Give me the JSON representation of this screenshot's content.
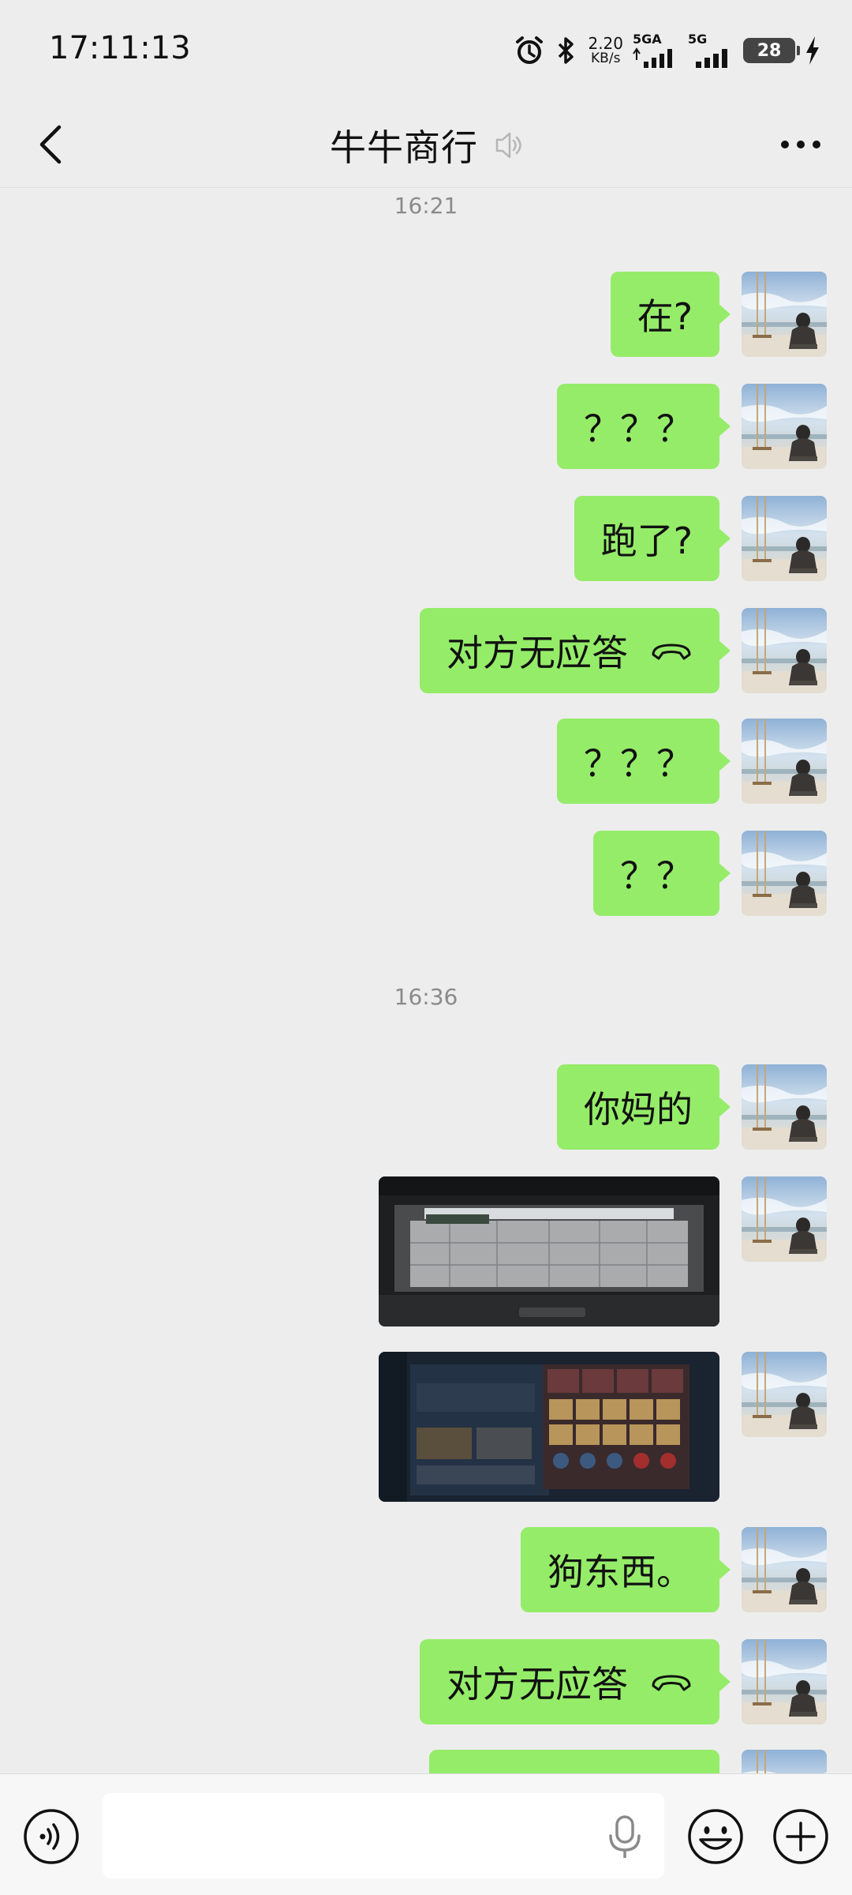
{
  "status_bar": {
    "time": "17:11:13",
    "net_speed_value": "2.20",
    "net_speed_unit": "KB/s",
    "sim1_label": "5GA",
    "sim2_label": "5G",
    "battery": "28",
    "icons": [
      "alarm-icon",
      "bluetooth-icon",
      "signal-icon",
      "battery-icon",
      "charging-icon"
    ]
  },
  "header": {
    "title": "牛牛商行",
    "icons": [
      "back-chevron-icon",
      "muted-speaker-icon",
      "more-dots-icon"
    ]
  },
  "timestamps": [
    "16:21",
    "16:36"
  ],
  "messages": [
    {
      "type": "text",
      "text": "在?"
    },
    {
      "type": "text",
      "text": "？？？"
    },
    {
      "type": "text",
      "text": "跑了?"
    },
    {
      "type": "call",
      "text": "对方无应答",
      "icon": "hangup-phone-icon"
    },
    {
      "type": "text",
      "text": "？？？"
    },
    {
      "type": "text",
      "text": "？？"
    },
    {
      "type": "text",
      "text": "你妈的"
    },
    {
      "type": "image",
      "description_icon": "game-screenshot-image"
    },
    {
      "type": "image",
      "description_icon": "game-inventory-image"
    },
    {
      "type": "text",
      "text": "狗东西。"
    },
    {
      "type": "call",
      "text": "对方无应答",
      "icon": "hangup-phone-icon"
    }
  ],
  "input": {
    "placeholder": "",
    "value": ""
  },
  "bottom_icons": [
    "voice-mode-icon",
    "microphone-icon",
    "emoji-icon",
    "plus-icon"
  ],
  "colors": {
    "bubble_self": "#95ec69",
    "background": "#ededed",
    "timestamp": "#8a8a8a"
  }
}
